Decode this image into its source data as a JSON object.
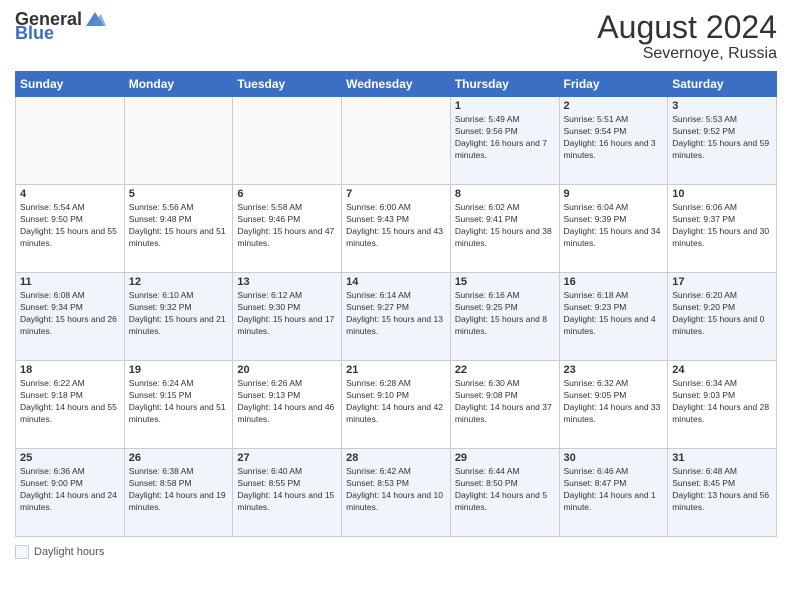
{
  "header": {
    "logo_general": "General",
    "logo_blue": "Blue",
    "month_year": "August 2024",
    "location": "Severnoye, Russia"
  },
  "days_of_week": [
    "Sunday",
    "Monday",
    "Tuesday",
    "Wednesday",
    "Thursday",
    "Friday",
    "Saturday"
  ],
  "weeks": [
    [
      {
        "day": "",
        "sunrise": "",
        "sunset": "",
        "daylight": "",
        "empty": true
      },
      {
        "day": "",
        "sunrise": "",
        "sunset": "",
        "daylight": "",
        "empty": true
      },
      {
        "day": "",
        "sunrise": "",
        "sunset": "",
        "daylight": "",
        "empty": true
      },
      {
        "day": "",
        "sunrise": "",
        "sunset": "",
        "daylight": "",
        "empty": true
      },
      {
        "day": "1",
        "sunrise": "Sunrise: 5:49 AM",
        "sunset": "Sunset: 9:56 PM",
        "daylight": "Daylight: 16 hours and 7 minutes."
      },
      {
        "day": "2",
        "sunrise": "Sunrise: 5:51 AM",
        "sunset": "Sunset: 9:54 PM",
        "daylight": "Daylight: 16 hours and 3 minutes."
      },
      {
        "day": "3",
        "sunrise": "Sunrise: 5:53 AM",
        "sunset": "Sunset: 9:52 PM",
        "daylight": "Daylight: 15 hours and 59 minutes."
      }
    ],
    [
      {
        "day": "4",
        "sunrise": "Sunrise: 5:54 AM",
        "sunset": "Sunset: 9:50 PM",
        "daylight": "Daylight: 15 hours and 55 minutes."
      },
      {
        "day": "5",
        "sunrise": "Sunrise: 5:56 AM",
        "sunset": "Sunset: 9:48 PM",
        "daylight": "Daylight: 15 hours and 51 minutes."
      },
      {
        "day": "6",
        "sunrise": "Sunrise: 5:58 AM",
        "sunset": "Sunset: 9:46 PM",
        "daylight": "Daylight: 15 hours and 47 minutes."
      },
      {
        "day": "7",
        "sunrise": "Sunrise: 6:00 AM",
        "sunset": "Sunset: 9:43 PM",
        "daylight": "Daylight: 15 hours and 43 minutes."
      },
      {
        "day": "8",
        "sunrise": "Sunrise: 6:02 AM",
        "sunset": "Sunset: 9:41 PM",
        "daylight": "Daylight: 15 hours and 38 minutes."
      },
      {
        "day": "9",
        "sunrise": "Sunrise: 6:04 AM",
        "sunset": "Sunset: 9:39 PM",
        "daylight": "Daylight: 15 hours and 34 minutes."
      },
      {
        "day": "10",
        "sunrise": "Sunrise: 6:06 AM",
        "sunset": "Sunset: 9:37 PM",
        "daylight": "Daylight: 15 hours and 30 minutes."
      }
    ],
    [
      {
        "day": "11",
        "sunrise": "Sunrise: 6:08 AM",
        "sunset": "Sunset: 9:34 PM",
        "daylight": "Daylight: 15 hours and 26 minutes."
      },
      {
        "day": "12",
        "sunrise": "Sunrise: 6:10 AM",
        "sunset": "Sunset: 9:32 PM",
        "daylight": "Daylight: 15 hours and 21 minutes."
      },
      {
        "day": "13",
        "sunrise": "Sunrise: 6:12 AM",
        "sunset": "Sunset: 9:30 PM",
        "daylight": "Daylight: 15 hours and 17 minutes."
      },
      {
        "day": "14",
        "sunrise": "Sunrise: 6:14 AM",
        "sunset": "Sunset: 9:27 PM",
        "daylight": "Daylight: 15 hours and 13 minutes."
      },
      {
        "day": "15",
        "sunrise": "Sunrise: 6:16 AM",
        "sunset": "Sunset: 9:25 PM",
        "daylight": "Daylight: 15 hours and 8 minutes."
      },
      {
        "day": "16",
        "sunrise": "Sunrise: 6:18 AM",
        "sunset": "Sunset: 9:23 PM",
        "daylight": "Daylight: 15 hours and 4 minutes."
      },
      {
        "day": "17",
        "sunrise": "Sunrise: 6:20 AM",
        "sunset": "Sunset: 9:20 PM",
        "daylight": "Daylight: 15 hours and 0 minutes."
      }
    ],
    [
      {
        "day": "18",
        "sunrise": "Sunrise: 6:22 AM",
        "sunset": "Sunset: 9:18 PM",
        "daylight": "Daylight: 14 hours and 55 minutes."
      },
      {
        "day": "19",
        "sunrise": "Sunrise: 6:24 AM",
        "sunset": "Sunset: 9:15 PM",
        "daylight": "Daylight: 14 hours and 51 minutes."
      },
      {
        "day": "20",
        "sunrise": "Sunrise: 6:26 AM",
        "sunset": "Sunset: 9:13 PM",
        "daylight": "Daylight: 14 hours and 46 minutes."
      },
      {
        "day": "21",
        "sunrise": "Sunrise: 6:28 AM",
        "sunset": "Sunset: 9:10 PM",
        "daylight": "Daylight: 14 hours and 42 minutes."
      },
      {
        "day": "22",
        "sunrise": "Sunrise: 6:30 AM",
        "sunset": "Sunset: 9:08 PM",
        "daylight": "Daylight: 14 hours and 37 minutes."
      },
      {
        "day": "23",
        "sunrise": "Sunrise: 6:32 AM",
        "sunset": "Sunset: 9:05 PM",
        "daylight": "Daylight: 14 hours and 33 minutes."
      },
      {
        "day": "24",
        "sunrise": "Sunrise: 6:34 AM",
        "sunset": "Sunset: 9:03 PM",
        "daylight": "Daylight: 14 hours and 28 minutes."
      }
    ],
    [
      {
        "day": "25",
        "sunrise": "Sunrise: 6:36 AM",
        "sunset": "Sunset: 9:00 PM",
        "daylight": "Daylight: 14 hours and 24 minutes."
      },
      {
        "day": "26",
        "sunrise": "Sunrise: 6:38 AM",
        "sunset": "Sunset: 8:58 PM",
        "daylight": "Daylight: 14 hours and 19 minutes."
      },
      {
        "day": "27",
        "sunrise": "Sunrise: 6:40 AM",
        "sunset": "Sunset: 8:55 PM",
        "daylight": "Daylight: 14 hours and 15 minutes."
      },
      {
        "day": "28",
        "sunrise": "Sunrise: 6:42 AM",
        "sunset": "Sunset: 8:53 PM",
        "daylight": "Daylight: 14 hours and 10 minutes."
      },
      {
        "day": "29",
        "sunrise": "Sunrise: 6:44 AM",
        "sunset": "Sunset: 8:50 PM",
        "daylight": "Daylight: 14 hours and 5 minutes."
      },
      {
        "day": "30",
        "sunrise": "Sunrise: 6:46 AM",
        "sunset": "Sunset: 8:47 PM",
        "daylight": "Daylight: 14 hours and 1 minute."
      },
      {
        "day": "31",
        "sunrise": "Sunrise: 6:48 AM",
        "sunset": "Sunset: 8:45 PM",
        "daylight": "Daylight: 13 hours and 56 minutes."
      }
    ]
  ],
  "footer": {
    "daylight_label": "Daylight hours"
  }
}
